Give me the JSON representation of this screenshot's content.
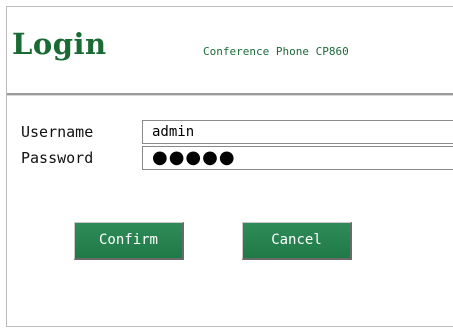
{
  "header": {
    "title": "Login",
    "device": "Conference Phone CP860"
  },
  "form": {
    "username_label": "Username",
    "username_value": "admin",
    "password_label": "Password",
    "password_mask": "●●●●●"
  },
  "buttons": {
    "confirm": "Confirm",
    "cancel": "Cancel"
  },
  "colors": {
    "brand_green": "#1a6b33",
    "button_green": "#278250"
  }
}
